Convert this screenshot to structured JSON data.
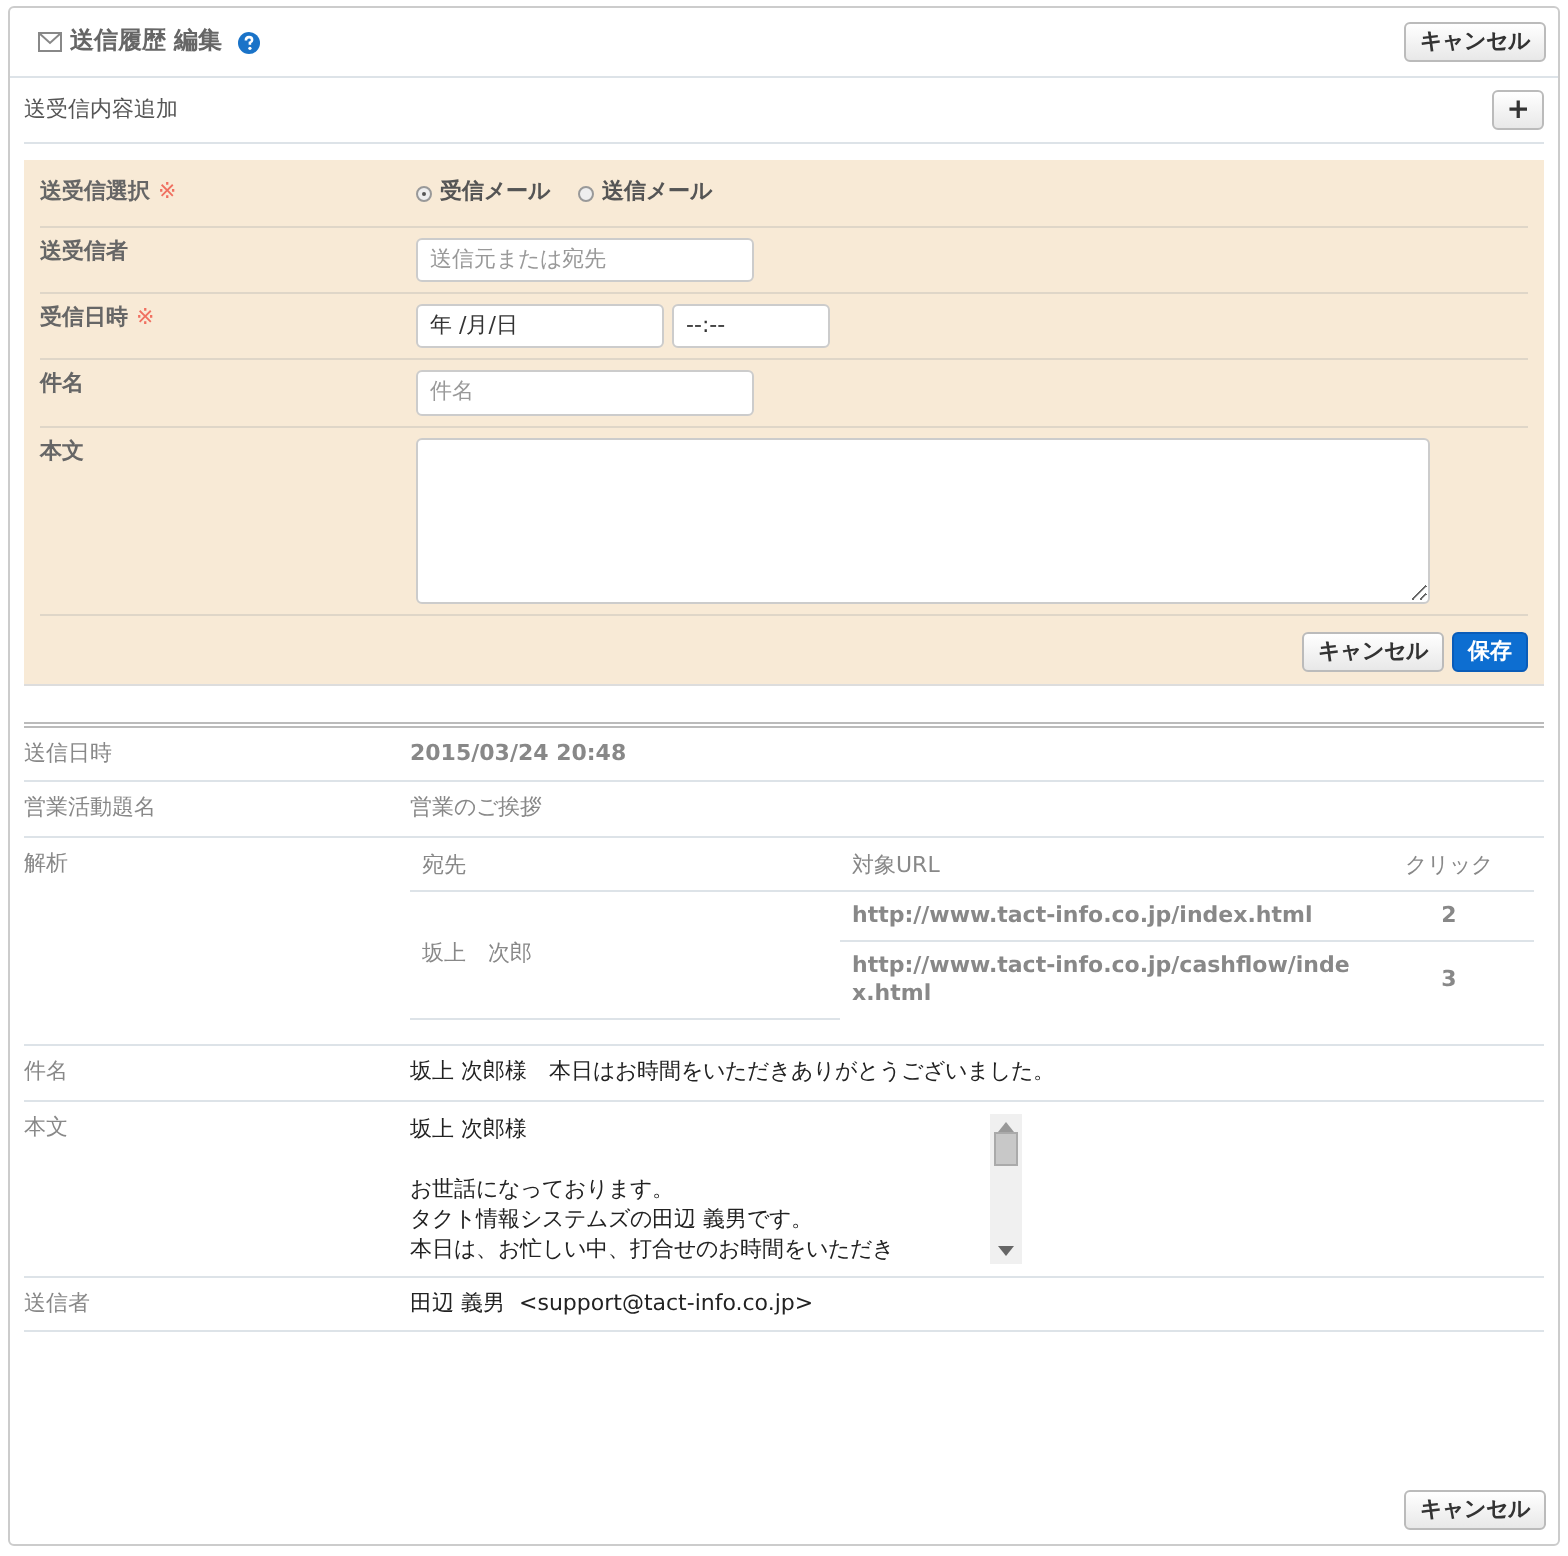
{
  "header": {
    "title": "送信履歴 編集",
    "cancel_button": "キャンセル"
  },
  "add_section": {
    "label": "送受信内容追加",
    "add_button": "+"
  },
  "form": {
    "rows": [
      {
        "kind": "radio",
        "label": "送受信選択",
        "required_mark": "※",
        "options": [
          {
            "label": "受信メール",
            "selected": true
          },
          {
            "label": "送信メール",
            "selected": false
          }
        ]
      },
      {
        "kind": "text",
        "label": "送受信者",
        "placeholder": "送信元または宛先"
      },
      {
        "kind": "datetime",
        "label": "受信日時",
        "required_mark": "※",
        "date_value": "年 /月/日",
        "time_value": "--:--"
      },
      {
        "kind": "text",
        "label": "件名",
        "placeholder": "件名"
      },
      {
        "kind": "textarea",
        "label": "本文"
      }
    ],
    "buttons": [
      {
        "label": "キャンセル",
        "kind": "secondary"
      },
      {
        "label": "保存",
        "kind": "primary"
      }
    ]
  },
  "details": {
    "rows": [
      {
        "kind": "text",
        "label": "送信日時",
        "value": "2015/03/24 20:48",
        "strong": true
      },
      {
        "kind": "text",
        "label": "営業活動題名",
        "value": "営業のご挨拶"
      },
      {
        "kind": "analysis",
        "label": "解析",
        "columns": [
          "宛先",
          "対象URL",
          "クリック"
        ],
        "recipient": "坂上　次郎",
        "links": [
          {
            "url": "http://www.tact-info.co.jp/index.html",
            "clicks": "2"
          },
          {
            "url": "http://www.tact-info.co.jp/cashflow/index.html",
            "clicks": "3"
          }
        ]
      },
      {
        "kind": "text",
        "label": "件名",
        "value": "坂上 次郎様　本日はお時間をいただきありがとうございました。",
        "dark": true
      },
      {
        "kind": "body",
        "label": "本文",
        "paragraphs": [
          [
            "坂上 次郎様"
          ],
          [
            "お世話になっております。",
            "タクト情報システムズの田辺 義男です。",
            "本日は、お忙しい中、打合せのお時間をいただき"
          ]
        ]
      },
      {
        "kind": "text",
        "label": "送信者",
        "value": "田辺 義男  <support@tact-info.co.jp>",
        "dark": true
      }
    ]
  },
  "footer": {
    "cancel_button": "キャンセル"
  }
}
